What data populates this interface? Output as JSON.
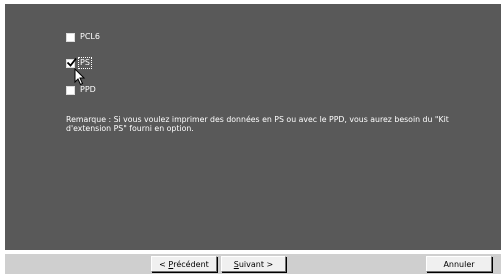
{
  "options": [
    {
      "label": "PCL6",
      "checked": false
    },
    {
      "label": "PS",
      "checked": true
    },
    {
      "label": "PPD",
      "checked": false
    }
  ],
  "remark": "Remarque : Si vous voulez imprimer des données en PS ou avec le PPD, vous aurez besoin du \"Kit\nd'extension PS\" fourni en option.",
  "buttons": {
    "prev_arrow": "< ",
    "prev_mnemonic": "P",
    "prev_rest": "récédent",
    "next_mnemonic": "S",
    "next_rest": "uivant >",
    "cancel": "Annuler"
  },
  "colors": {
    "panel": "#595959",
    "bottombar": "#cfcfcf"
  }
}
